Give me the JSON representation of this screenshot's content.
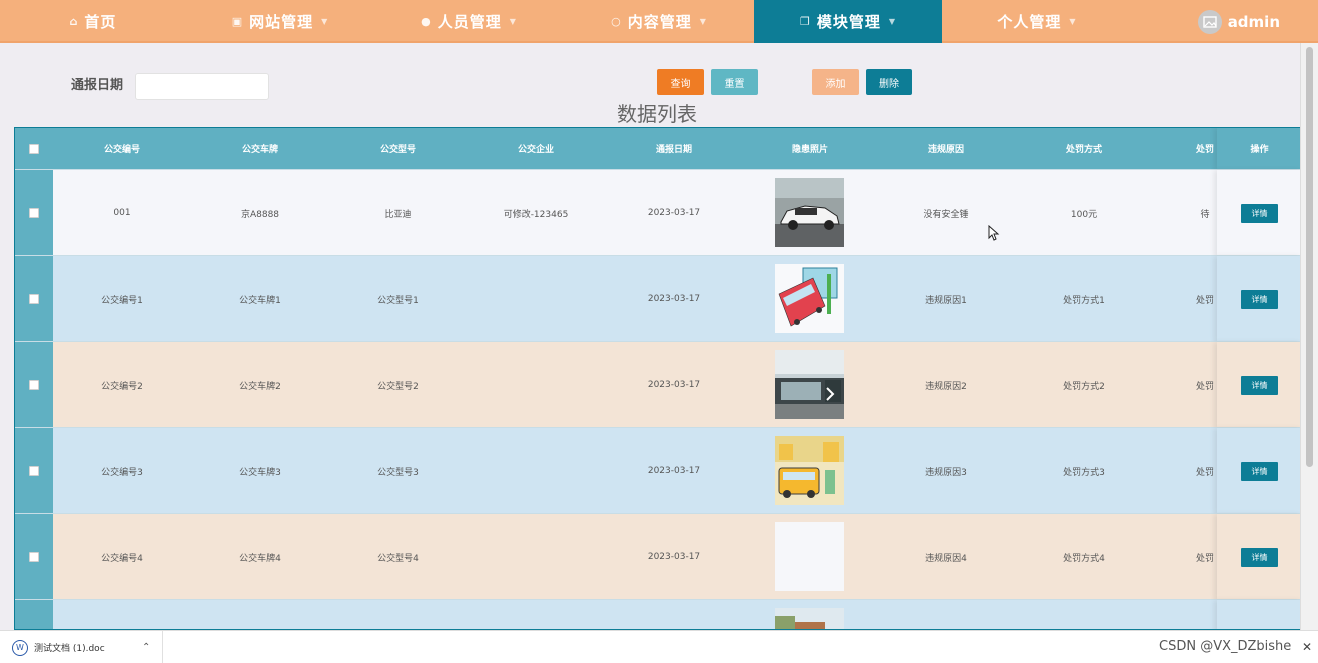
{
  "nav": {
    "items": [
      {
        "label": "首页",
        "icon": "home-icon",
        "caret": false
      },
      {
        "label": "网站管理",
        "icon": "monitor-icon",
        "caret": true
      },
      {
        "label": "人员管理",
        "icon": "user-icon",
        "caret": true
      },
      {
        "label": "内容管理",
        "icon": "message-icon",
        "caret": true
      },
      {
        "label": "模块管理",
        "icon": "module-icon",
        "caret": true,
        "active": true
      },
      {
        "label": "个人管理",
        "icon": "",
        "caret": true
      }
    ],
    "user": "admin"
  },
  "search": {
    "label": "通报日期",
    "value": "",
    "placeholder": ""
  },
  "buttons": {
    "query": "查询",
    "reset": "重置",
    "add": "添加",
    "delete": "删除"
  },
  "list_title": "数据列表",
  "table": {
    "headers": [
      "公交编号",
      "公交车牌",
      "公交型号",
      "公交企业",
      "通报日期",
      "隐患照片",
      "违规原因",
      "处罚方式",
      "处罚",
      "操作"
    ],
    "rows": [
      {
        "id": "001",
        "plate": "京A8888",
        "model": "比亚迪",
        "company": "可修改-123465",
        "date": "2023-03-17",
        "reason": "没有安全锤",
        "penalty": "100元",
        "more": "待",
        "detail": "详情"
      },
      {
        "id": "公交编号1",
        "plate": "公交车牌1",
        "model": "公交型号1",
        "company": "",
        "date": "2023-03-17",
        "reason": "违规原因1",
        "penalty": "处罚方式1",
        "more": "处罚",
        "detail": "详情"
      },
      {
        "id": "公交编号2",
        "plate": "公交车牌2",
        "model": "公交型号2",
        "company": "",
        "date": "2023-03-17",
        "reason": "违规原因2",
        "penalty": "处罚方式2",
        "more": "处罚",
        "detail": "详情"
      },
      {
        "id": "公交编号3",
        "plate": "公交车牌3",
        "model": "公交型号3",
        "company": "",
        "date": "2023-03-17",
        "reason": "违规原因3",
        "penalty": "处罚方式3",
        "more": "处罚",
        "detail": "详情"
      },
      {
        "id": "公交编号4",
        "plate": "公交车牌4",
        "model": "公交型号4",
        "company": "",
        "date": "2023-03-17",
        "reason": "违规原因4",
        "penalty": "处罚方式4",
        "more": "处罚",
        "detail": "详情"
      }
    ]
  },
  "download": {
    "filename": "测试文档 (1).doc"
  },
  "watermark": "CSDN @VX_DZbishe",
  "colors": {
    "nav": "#f5b07c",
    "nav_active": "#0d7d96",
    "table_header": "#60b0c2",
    "query": "#ef7c24",
    "reset": "#5fb7c4",
    "add": "#f5b489",
    "delete": "#0d7d96"
  }
}
